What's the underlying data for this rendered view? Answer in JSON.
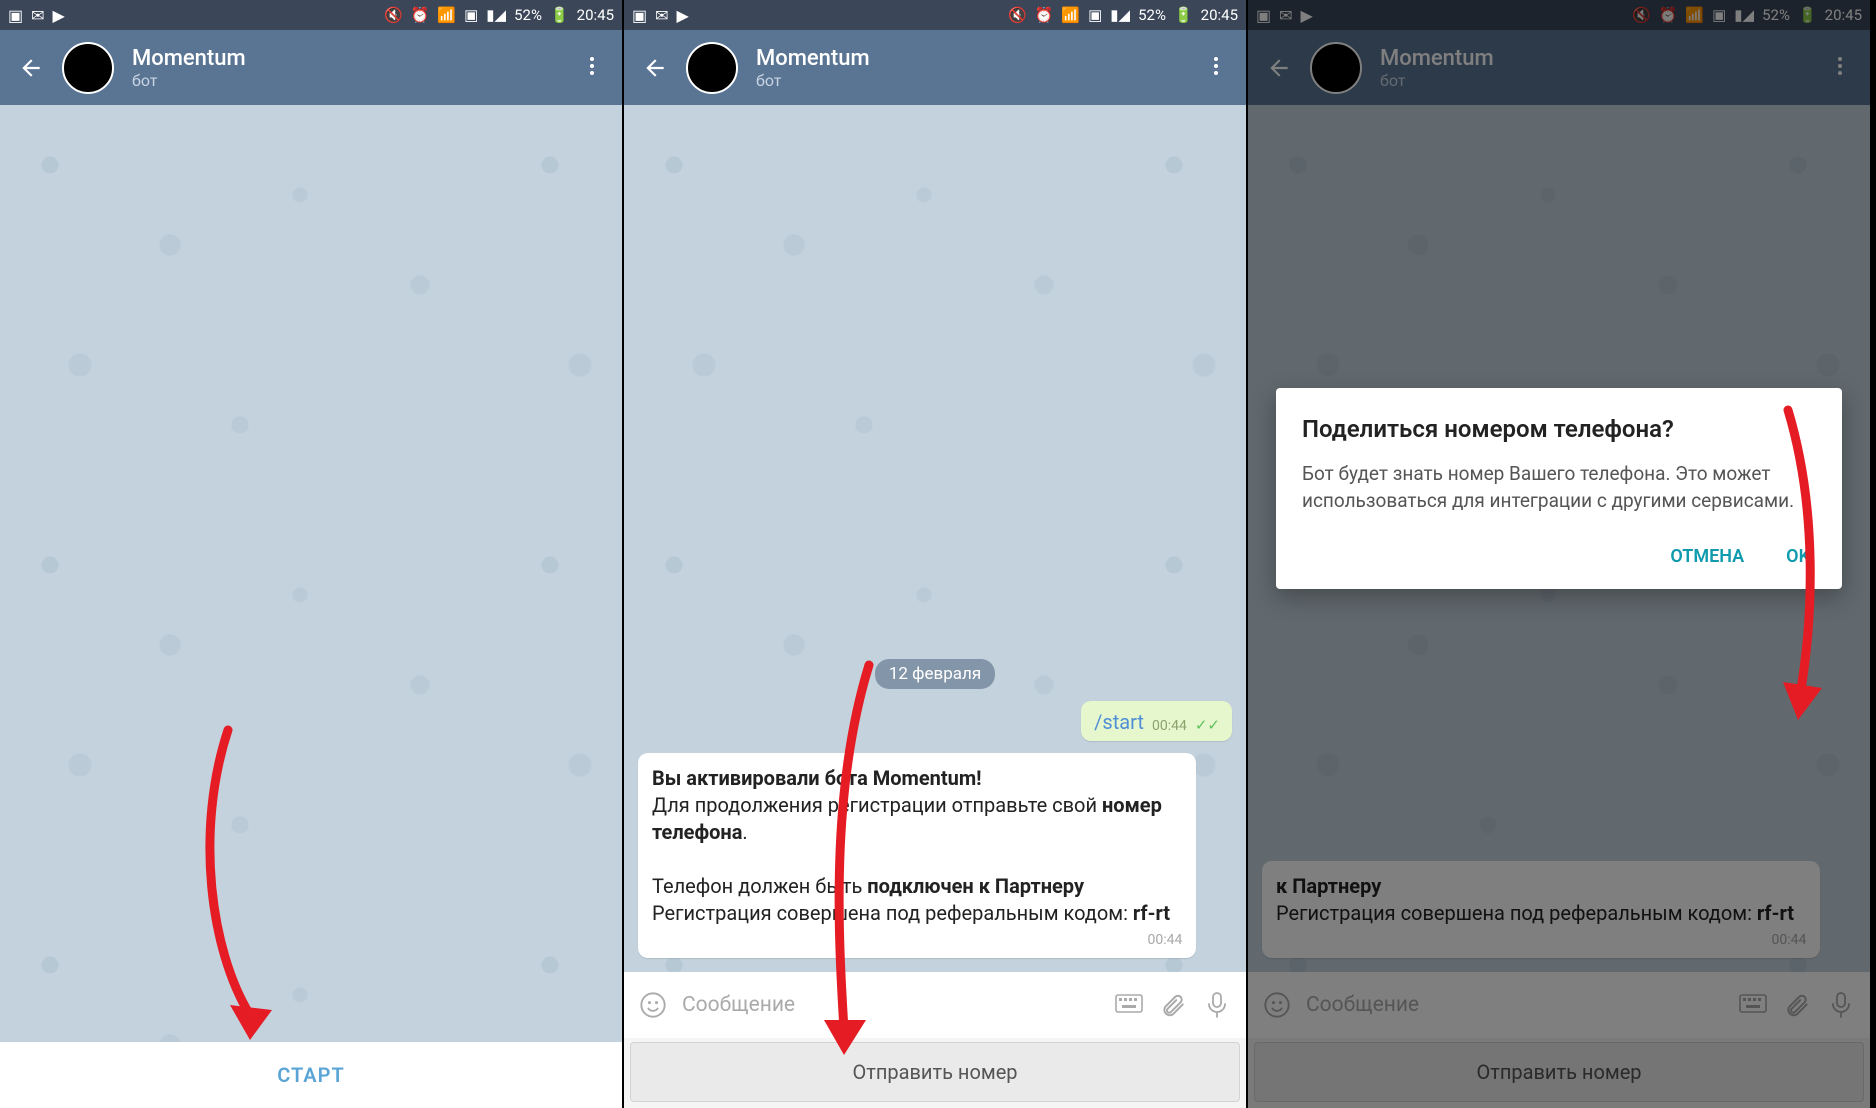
{
  "status": {
    "battery": "52%",
    "time": "20:45"
  },
  "header": {
    "title": "Momentum",
    "subtitle": "бот"
  },
  "screen1": {
    "start_button": "СТАРТ"
  },
  "screen2": {
    "date": "12 февраля",
    "out_msg": "/start",
    "out_time": "00:44",
    "in_bold1": "Вы активировали бота Momentum!",
    "in_line2a": "Для продолжения регистрации отправьте свой ",
    "in_line2b": "номер телефона",
    "in_line3a": "Телефон должен быть ",
    "in_line3b": "подключен к Партнеру",
    "in_line4": "Регистрация совершена под реферальным кодом: ",
    "in_code": "rf-rt",
    "in_time": "00:44",
    "input_placeholder": "Сообщение",
    "send_number": "Отправить номер"
  },
  "screen3": {
    "dialog_title": "Поделиться номером телефона?",
    "dialog_body": "Бот будет знать номер Вашего телефона. Это может использоваться для интеграции с другими сервисами.",
    "cancel": "ОТМЕНА",
    "ok": "OK",
    "in_line3b2": "к Партнеру",
    "in_line4": "Регистрация совершена под реферальным кодом: ",
    "in_code": "rf-rt",
    "in_time": "00:44",
    "input_placeholder": "Сообщение",
    "send_number": "Отправить номер"
  }
}
